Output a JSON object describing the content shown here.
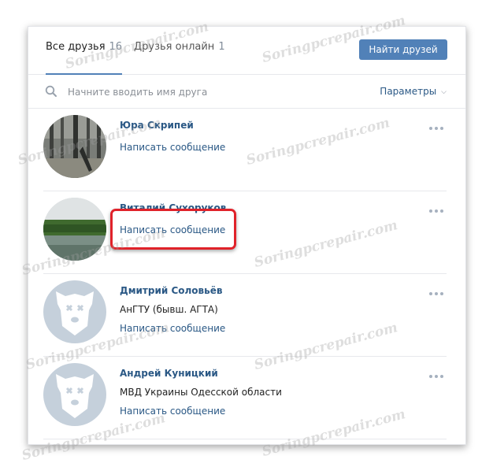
{
  "tabs": [
    {
      "label": "Все друзья",
      "count": "16"
    },
    {
      "label": "Друзья онлайн",
      "count": "1"
    }
  ],
  "find_button": "Найти друзей",
  "search": {
    "placeholder": "Начните вводить имя друга"
  },
  "params_label": "Параметры",
  "friends": [
    {
      "name": "Юра Скрипей",
      "subtitle": "",
      "message": "Написать сообщение"
    },
    {
      "name": "Виталий Сухоруков",
      "subtitle": "",
      "message": "Написать сообщение"
    },
    {
      "name": "Дмитрий Соловьёв",
      "subtitle": "АнГТУ (бывш. АГТА)",
      "message": "Написать сообщение"
    },
    {
      "name": "Андрей Куницкий",
      "subtitle": "МВД Украины Одесской области",
      "message": "Написать сообщение"
    }
  ],
  "watermark": "Soringpcrepair.com",
  "colors": {
    "accent": "#5181b8",
    "link": "#2a5885",
    "highlight": "#e0222a"
  }
}
